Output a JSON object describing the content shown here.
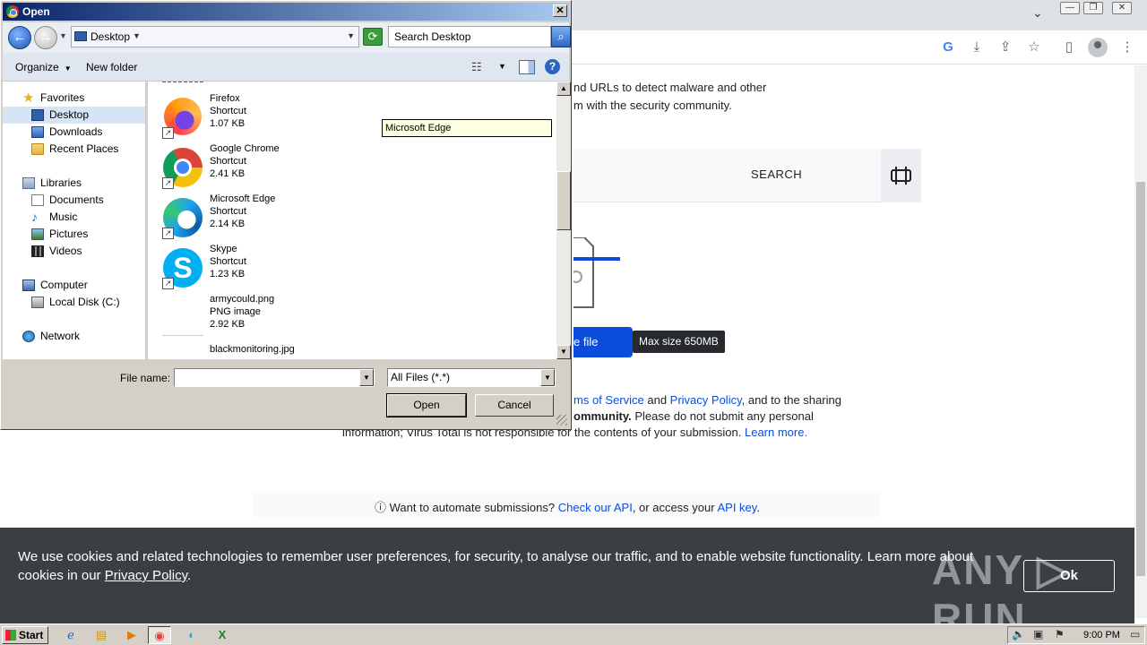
{
  "browser": {
    "minimize": "—",
    "maximize": "❐",
    "close": "✕",
    "menu": "⋮"
  },
  "page": {
    "intro_line1": "nd URLs to detect malware and other",
    "intro_line2": "m with the security community.",
    "search_label": "SEARCH",
    "choose_file_label": "e file",
    "max_size": "Max size 650MB",
    "terms_line1_prefix": "ms of Service",
    "terms_line1_and": " and ",
    "terms_privacy": "Privacy Policy",
    "terms_line1_suffix": ", and to the sharing",
    "terms_line2": "ommunity.",
    "terms_line2_rest": " Please do not submit any personal",
    "terms_line3": "information; Virus Total is not responsible for the contents of your submission. ",
    "learn_more": "Learn more.",
    "automate_prefix": "ⓘ  Want to automate submissions? ",
    "check_api": "Check our API",
    "automate_mid": ", or access your ",
    "api_key": "API key",
    "automate_suffix": "."
  },
  "cookie": {
    "text": "We use cookies and related technologies to remember user preferences, for security, to analyse our traffic, and to enable website functionality. Learn more about cookies in our ",
    "link": "Privacy Policy",
    "text_end": ".",
    "ok": "Ok",
    "watermark": "ANY ▷ RUN"
  },
  "taskbar": {
    "start": "Start",
    "clock": "9:00 PM"
  },
  "dialog": {
    "title": "Open",
    "close": "✕",
    "address": "Desktop",
    "search_placeholder": "Search Desktop",
    "organize": "Organize",
    "new_folder": "New folder",
    "help": "?",
    "nav": {
      "favorites": "Favorites",
      "desktop": "Desktop",
      "downloads": "Downloads",
      "recent": "Recent Places",
      "libraries": "Libraries",
      "documents": "Documents",
      "music": "Music",
      "pictures": "Pictures",
      "videos": "Videos",
      "computer": "Computer",
      "local_disk": "Local Disk (C:)",
      "network": "Network"
    },
    "files": [
      {
        "name": "Firefox",
        "type": "Shortcut",
        "size": "1.07 KB"
      },
      {
        "name": "Google Chrome",
        "type": "Shortcut",
        "size": "2.41 KB"
      },
      {
        "name": "Microsoft Edge",
        "type": "Shortcut",
        "size": "2.14 KB"
      },
      {
        "name": "Skype",
        "type": "Shortcut",
        "size": "1.23 KB"
      },
      {
        "name": "armycould.png",
        "type": "PNG image",
        "size": "2.92 KB"
      },
      {
        "name": "blackmonitoring.jpg",
        "type": "",
        "size": ""
      }
    ],
    "tooltip": "Microsoft Edge",
    "file_name_label": "File name:",
    "file_name_value": "",
    "file_type": "All Files (*.*)",
    "open": "Open",
    "cancel": "Cancel"
  }
}
